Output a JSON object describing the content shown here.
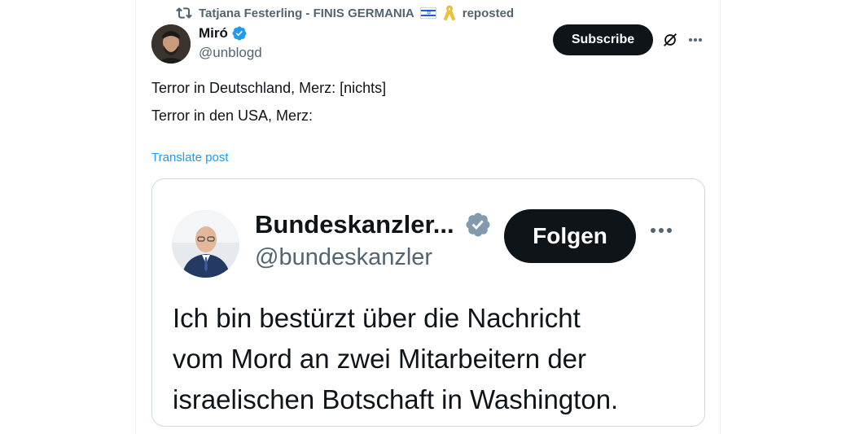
{
  "repost": {
    "reposter_name": "Tatjana Festerling - FINIS GERMANIA",
    "suffix": "reposted"
  },
  "post": {
    "author_name": "Miró",
    "author_handle": "@unblogd",
    "subscribe_label": "Subscribe",
    "text_lines": [
      "Terror in Deutschland, Merz: [nichts]",
      "Terror in den USA, Merz:"
    ],
    "translate_label": "Translate post"
  },
  "embedded_screenshot": {
    "name": "Bundeskanzler...",
    "handle": "@bundeskanzler",
    "follow_label": "Folgen",
    "text_lines": [
      "Ich bin bestürzt über die Nachricht",
      "vom Mord an zwei Mitarbeitern der",
      "israelischen Botschaft in Washington."
    ]
  },
  "icons": {
    "repost": "repost-icon",
    "verified": "verified-badge-icon",
    "grok": "grok-icon",
    "more": "more-options-icon"
  },
  "colors": {
    "accent_link": "#1d9bf0",
    "text_primary": "#0f1419",
    "text_secondary": "#536471",
    "verified_blue": "#1d9bf0",
    "verified_gray": "#829aab",
    "button_dark": "#0f1419"
  }
}
